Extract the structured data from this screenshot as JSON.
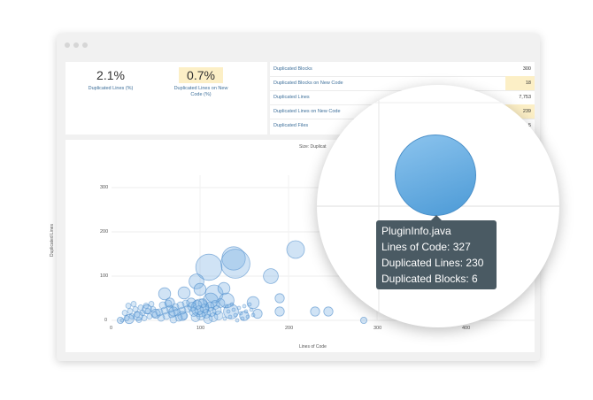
{
  "summary": {
    "dup_lines_pct": {
      "value": "2.1%",
      "label": "Duplicated Lines (%)"
    },
    "dup_lines_new_pct": {
      "value": "0.7%",
      "label": "Duplicated Lines on New Code (%)"
    }
  },
  "table": {
    "rows": [
      {
        "label": "Duplicated Blocks",
        "value": "300"
      },
      {
        "label": "Duplicated Blocks on New Code",
        "value": "18"
      },
      {
        "label": "Duplicated Lines",
        "value": "7,753"
      },
      {
        "label": "Duplicated Lines on New Code",
        "value": "239"
      },
      {
        "label": "Duplicated Files",
        "value": "5"
      }
    ]
  },
  "chart": {
    "size_label": "Size: Duplicat",
    "xlabel": "Lines of Code",
    "ylabel": "Duplicated Lines",
    "x_ticks": [
      "0",
      "100",
      "200",
      "300",
      "400"
    ],
    "y_ticks": [
      "300",
      "200",
      "100",
      "0"
    ]
  },
  "chart_data": {
    "type": "scatter",
    "xlabel": "Lines of Code",
    "ylabel": "Duplicated Lines",
    "xlim": [
      0,
      430
    ],
    "ylim": [
      0,
      310
    ],
    "points": [
      {
        "x": 138,
        "y": 140,
        "r": 7
      },
      {
        "x": 140,
        "y": 128,
        "r": 9
      },
      {
        "x": 110,
        "y": 120,
        "r": 8
      },
      {
        "x": 208,
        "y": 160,
        "r": 5
      },
      {
        "x": 96,
        "y": 88,
        "r": 4
      },
      {
        "x": 116,
        "y": 60,
        "r": 5
      },
      {
        "x": 100,
        "y": 70,
        "r": 3
      },
      {
        "x": 60,
        "y": 60,
        "r": 3
      },
      {
        "x": 82,
        "y": 62,
        "r": 3
      },
      {
        "x": 127,
        "y": 72,
        "r": 3
      },
      {
        "x": 112,
        "y": 45,
        "r": 4
      },
      {
        "x": 100,
        "y": 28,
        "r": 5
      },
      {
        "x": 180,
        "y": 100,
        "r": 4
      },
      {
        "x": 130,
        "y": 45,
        "r": 4
      },
      {
        "x": 135,
        "y": 20,
        "r": 4
      },
      {
        "x": 160,
        "y": 40,
        "r": 3
      },
      {
        "x": 190,
        "y": 50,
        "r": 2
      },
      {
        "x": 190,
        "y": 20,
        "r": 2
      },
      {
        "x": 230,
        "y": 20,
        "r": 2
      },
      {
        "x": 245,
        "y": 20,
        "r": 2
      },
      {
        "x": 50,
        "y": 15,
        "r": 2
      },
      {
        "x": 40,
        "y": 25,
        "r": 2
      },
      {
        "x": 30,
        "y": 10,
        "r": 2
      },
      {
        "x": 20,
        "y": 3,
        "r": 2
      },
      {
        "x": 66,
        "y": 40,
        "r": 2
      },
      {
        "x": 70,
        "y": 20,
        "r": 2
      },
      {
        "x": 90,
        "y": 40,
        "r": 2
      },
      {
        "x": 80,
        "y": 10,
        "r": 2
      },
      {
        "x": 150,
        "y": 10,
        "r": 2
      },
      {
        "x": 165,
        "y": 15,
        "r": 2
      },
      {
        "x": 285,
        "y": 0,
        "r": 1
      },
      {
        "x": 10,
        "y": 0,
        "r": 1
      },
      {
        "x": 327,
        "y": 230,
        "r": 6
      }
    ],
    "size_metric": "Duplicated Blocks"
  },
  "tooltip": {
    "file": "PluginInfo.java",
    "loc": "Lines of Code: 327",
    "dup_lines": "Duplicated Lines: 230",
    "dup_blocks": "Duplicated Blocks: 6"
  }
}
